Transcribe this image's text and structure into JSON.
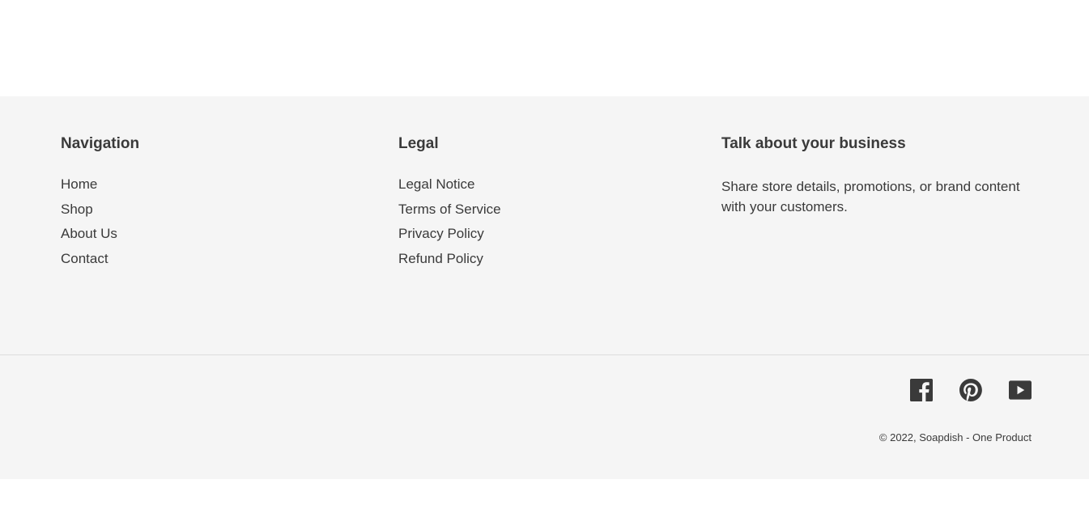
{
  "navigation": {
    "heading": "Navigation",
    "items": [
      "Home",
      "Shop",
      "About Us",
      "Contact"
    ]
  },
  "legal": {
    "heading": "Legal",
    "items": [
      "Legal Notice",
      "Terms of Service",
      "Privacy Policy",
      "Refund Policy"
    ]
  },
  "business": {
    "heading": "Talk about your business",
    "text": "Share store details, promotions, or brand content with your customers."
  },
  "social": {
    "icons": [
      "facebook-icon",
      "pinterest-icon",
      "youtube-icon"
    ]
  },
  "copyright": {
    "prefix": "© 2022, ",
    "store_name": "Soapdish - One Product"
  },
  "colors": {
    "footer_bg": "#f5f5f5",
    "text": "#3a3a3a",
    "divider": "#dddddd"
  }
}
